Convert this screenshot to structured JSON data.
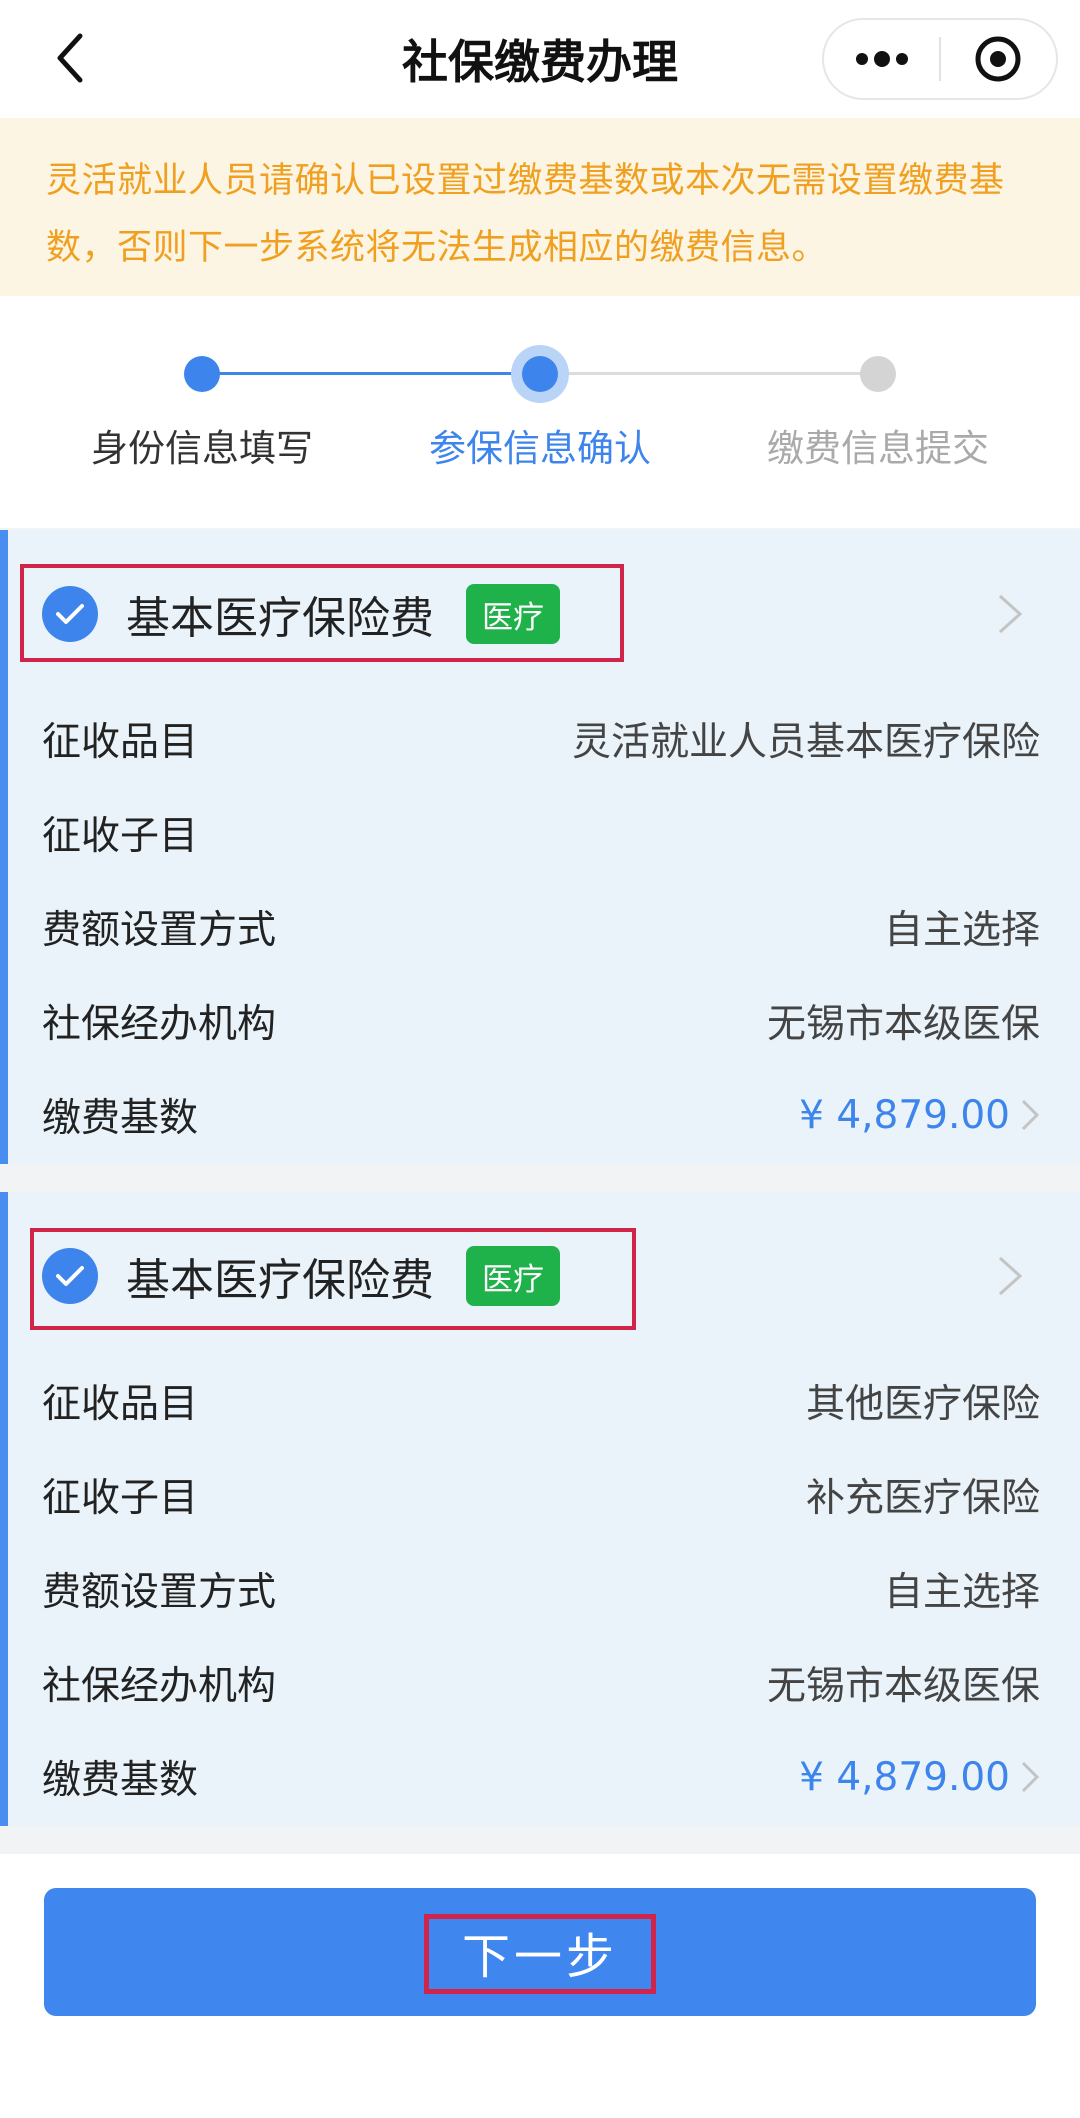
{
  "nav": {
    "title": "社保缴费办理"
  },
  "notice": "灵活就业人员请确认已设置过缴费基数或本次无需设置缴费基数，否则下一步系统将无法生成相应的缴费信息。",
  "steps": [
    {
      "label": "身份信息填写",
      "state": "done"
    },
    {
      "label": "参保信息确认",
      "state": "current"
    },
    {
      "label": "缴费信息提交",
      "state": "pending"
    }
  ],
  "colors": {
    "accent": "#3d85ec",
    "notice_text": "#f0a020",
    "notice_bg": "#fdf5e3",
    "tag_green": "#1fb24a",
    "highlight_red": "#d1244b"
  },
  "cards": [
    {
      "title": "基本医疗保险费",
      "tag": "医疗",
      "checked": true,
      "rows": [
        {
          "label": "征收品目",
          "value": "灵活就业人员基本医疗保险"
        },
        {
          "label": "征收子目",
          "value": ""
        },
        {
          "label": "费额设置方式",
          "value": "自主选择"
        },
        {
          "label": "社保经办机构",
          "value": "无锡市本级医保"
        },
        {
          "label": "缴费基数",
          "value": "¥ 4,879.00"
        }
      ]
    },
    {
      "title": "基本医疗保险费",
      "tag": "医疗",
      "checked": true,
      "rows": [
        {
          "label": "征收品目",
          "value": "其他医疗保险"
        },
        {
          "label": "征收子目",
          "value": "补充医疗保险"
        },
        {
          "label": "费额设置方式",
          "value": "自主选择"
        },
        {
          "label": "社保经办机构",
          "value": "无锡市本级医保"
        },
        {
          "label": "缴费基数",
          "value": "¥ 4,879.00"
        }
      ]
    }
  ],
  "next_button": "下一步"
}
